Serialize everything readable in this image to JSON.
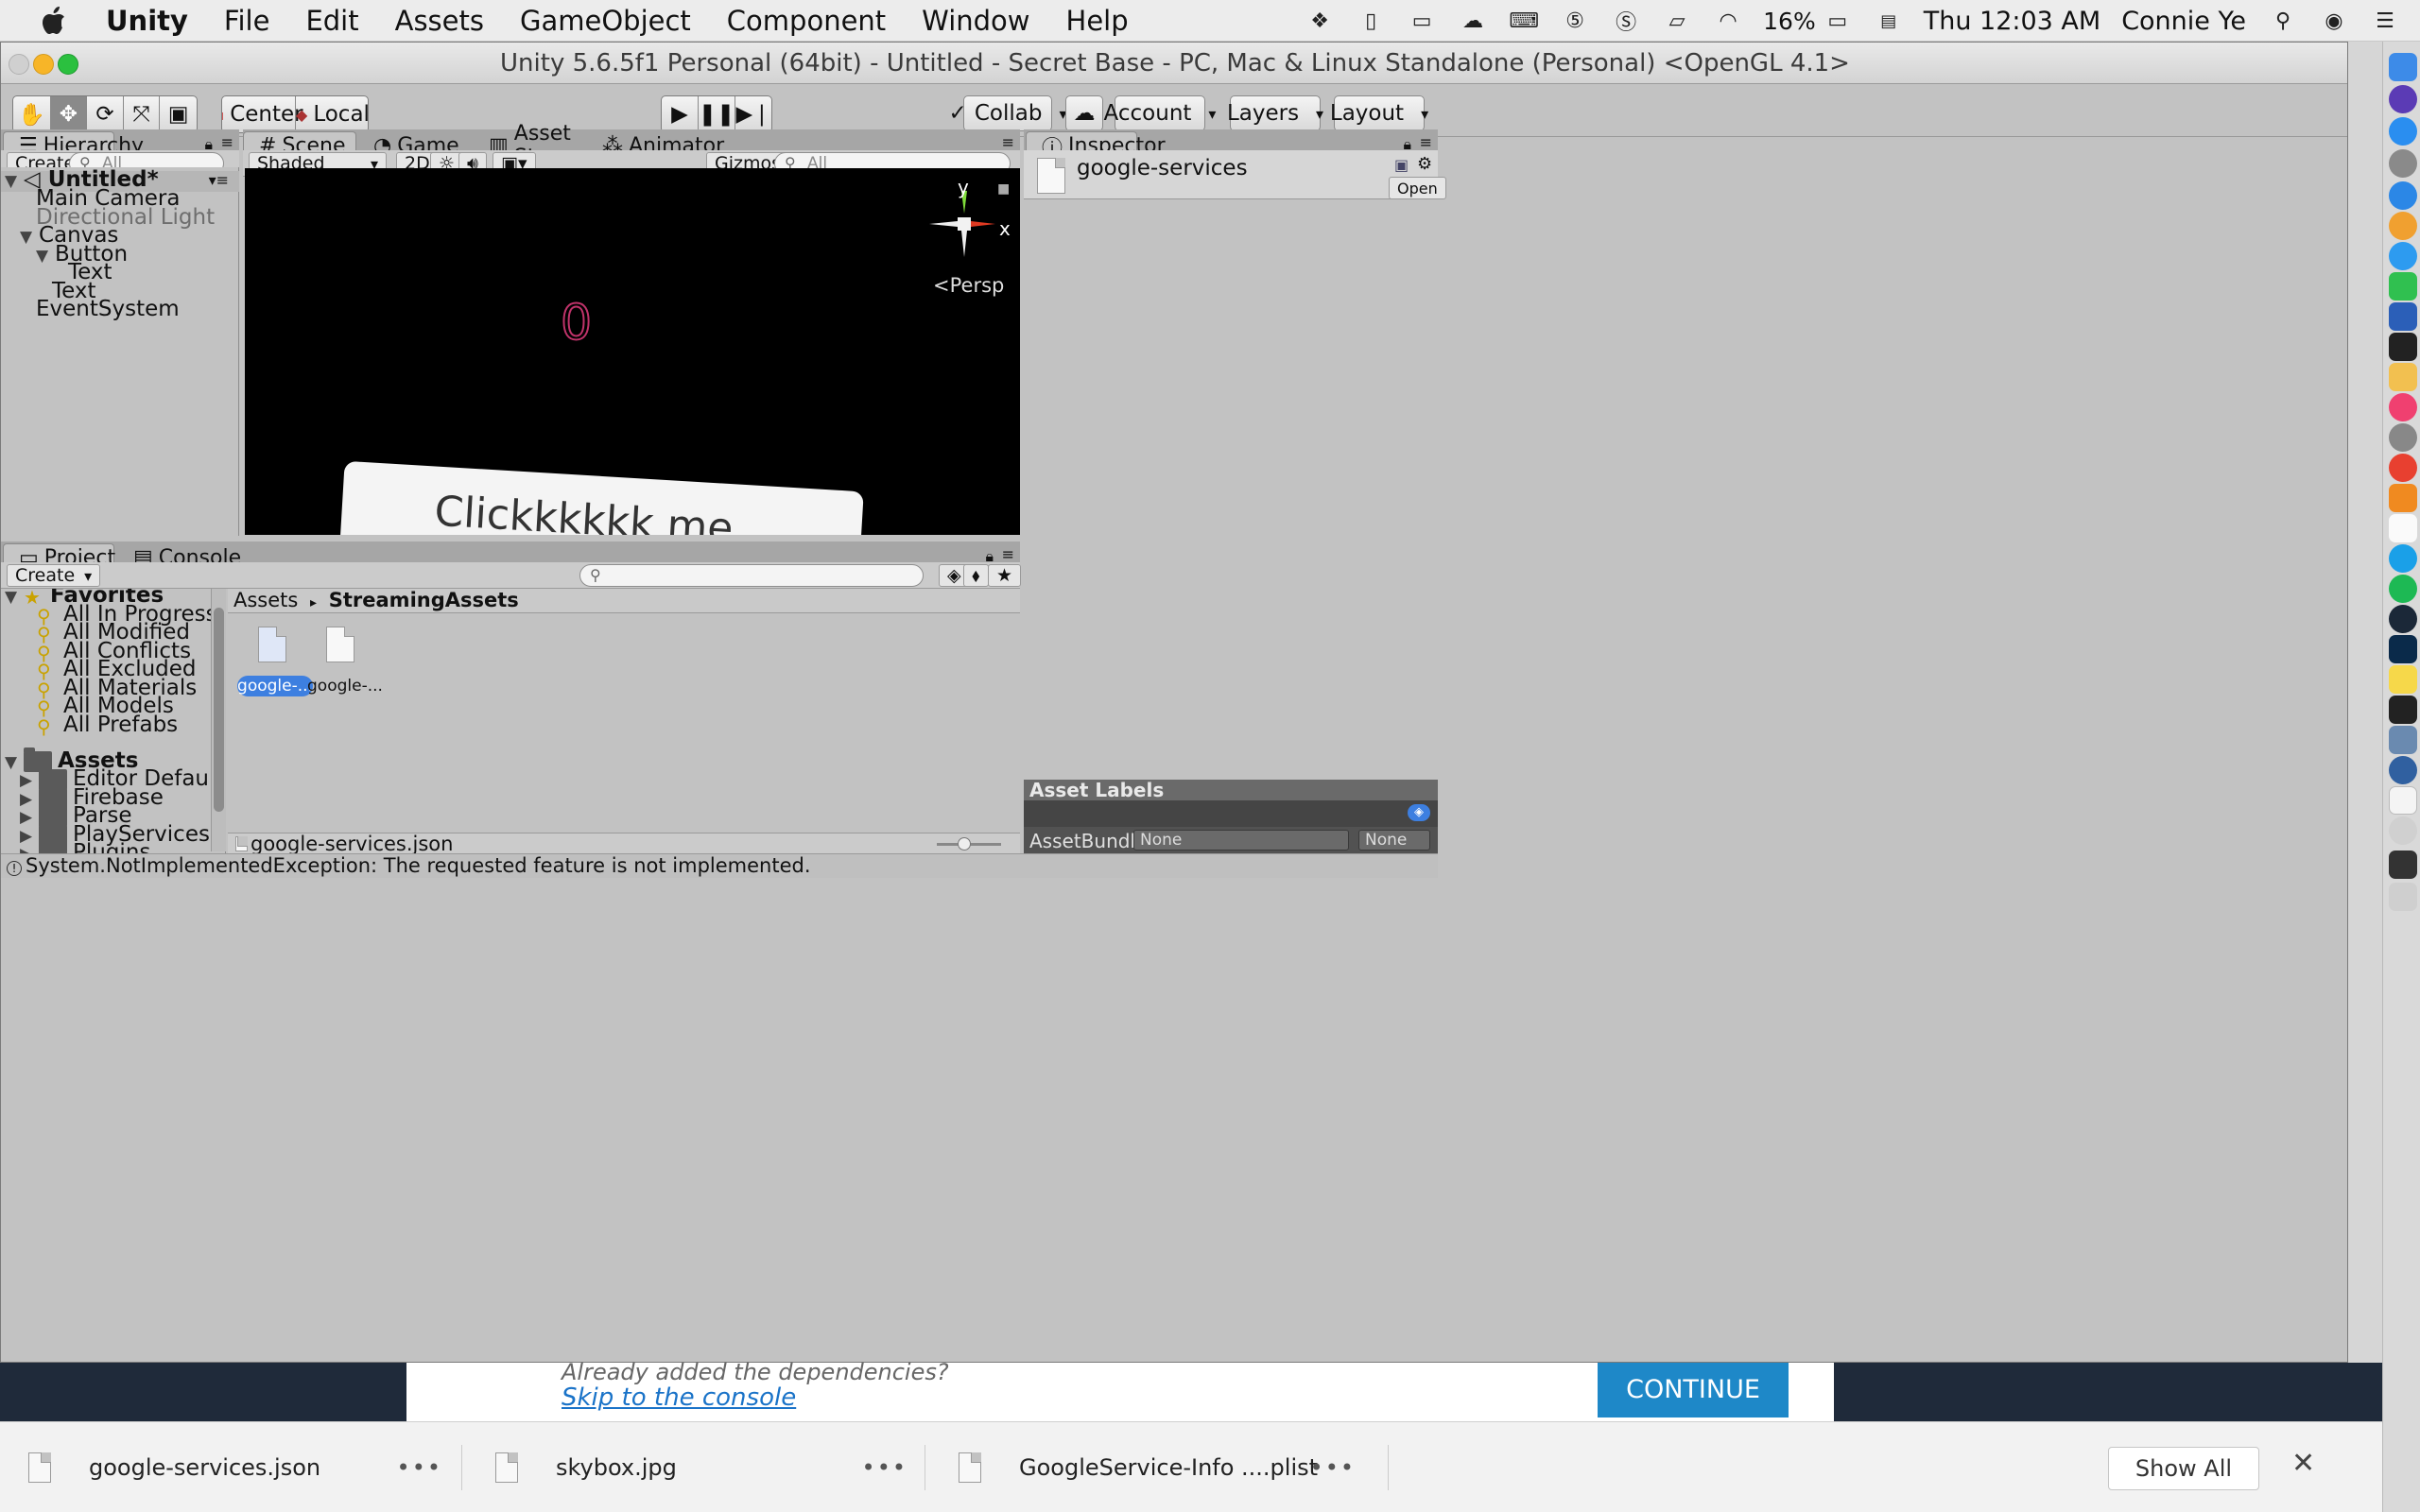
{
  "menubar": {
    "app": "Unity",
    "items": [
      "File",
      "Edit",
      "Assets",
      "GameObject",
      "Component",
      "Window",
      "Help"
    ],
    "battery": "16%",
    "clock": "Thu 12:03 AM",
    "user": "Connie Ye"
  },
  "window": {
    "title": "Unity 5.6.5f1 Personal (64bit) - Untitled - Secret Base - PC, Mac & Linux Standalone (Personal) <OpenGL 4.1>"
  },
  "toolbar": {
    "pivot": "Center",
    "space": "Local",
    "collab": "Collab",
    "account": "Account",
    "layers": "Layers",
    "layout": "Layout"
  },
  "hierarchy": {
    "tab": "Hierarchy",
    "create": "Create",
    "search_placeholder": "All",
    "scene_name": "Untitled*",
    "items": [
      "Main Camera",
      "Directional Light",
      "Canvas",
      "Button",
      "Text",
      "Text",
      "EventSystem"
    ]
  },
  "scene_tabs": [
    "Scene",
    "Game",
    "Asset Store",
    "Animator"
  ],
  "scene_bar": {
    "shading": "Shaded",
    "mode_2d": "2D",
    "gizmos": "Gizmos",
    "search_placeholder": "All"
  },
  "scene_view": {
    "axis_y": "y",
    "axis_x": "x",
    "persp": "Persp",
    "counter": "0",
    "button_text": "Clickkkkkk me"
  },
  "inspector": {
    "tab": "Inspector",
    "asset_name": "google-services",
    "open_button": "Open",
    "asset_labels": "Asset Labels",
    "assetbundle_label": "AssetBundle",
    "bundle_name": "None",
    "bundle_variant": "None"
  },
  "project": {
    "tabs": [
      "Project",
      "Console"
    ],
    "create": "Create",
    "favorites_label": "Favorites",
    "favorites": [
      "All In Progress",
      "All Modified",
      "All Conflicts",
      "All Excluded",
      "All Materials",
      "All Models",
      "All Prefabs"
    ],
    "assets_label": "Assets",
    "folders": [
      "Editor Default Resources",
      "Firebase",
      "Parse",
      "PlayServicesResolver",
      "Plugins"
    ],
    "breadcrumb": [
      "Assets",
      "StreamingAssets"
    ],
    "files": [
      "google-...",
      "google-..."
    ],
    "selected_path": "google-services.json"
  },
  "status": {
    "message": "System.NotImplementedException: The requested feature is not implemented."
  },
  "browser_behind": {
    "text": "Already added the dependencies?",
    "link": "Skip to the console",
    "button": "CONTINUE"
  },
  "downloads": {
    "items": [
      "google-services.json",
      "skybox.jpg",
      "GoogleService-Info ....plist"
    ],
    "show_all": "Show All"
  },
  "colors": {
    "selection": "#3d7fe0",
    "scene_bg": "#000000",
    "counter": "#c0336a",
    "continue_btn": "#1e88c8"
  }
}
